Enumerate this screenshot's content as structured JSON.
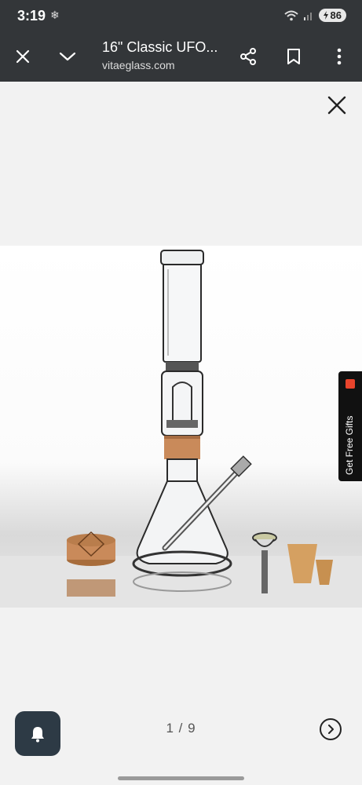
{
  "status_bar": {
    "time": "3:19",
    "battery": "86",
    "icons": [
      "snowflake-icon",
      "wifi-icon",
      "signal-icon",
      "battery-icon"
    ]
  },
  "toolbar": {
    "title": "16\" Classic UFO...",
    "url": "vitaeglass.com",
    "icons": [
      "close-icon",
      "chevron-down-icon",
      "share-icon",
      "bookmark-icon",
      "more-vert-icon"
    ]
  },
  "viewer": {
    "close_icon": "close-icon",
    "image_alt": "16\" Classic UFO beaker bong with accessories",
    "counter": "1 / 9"
  },
  "promo": {
    "gifts_label": "Get Free Gifts",
    "gift_color": "#e8442c"
  },
  "colors": {
    "chrome": "#333639",
    "bell_button": "#2d3a45",
    "wood": "#c98a5a"
  }
}
